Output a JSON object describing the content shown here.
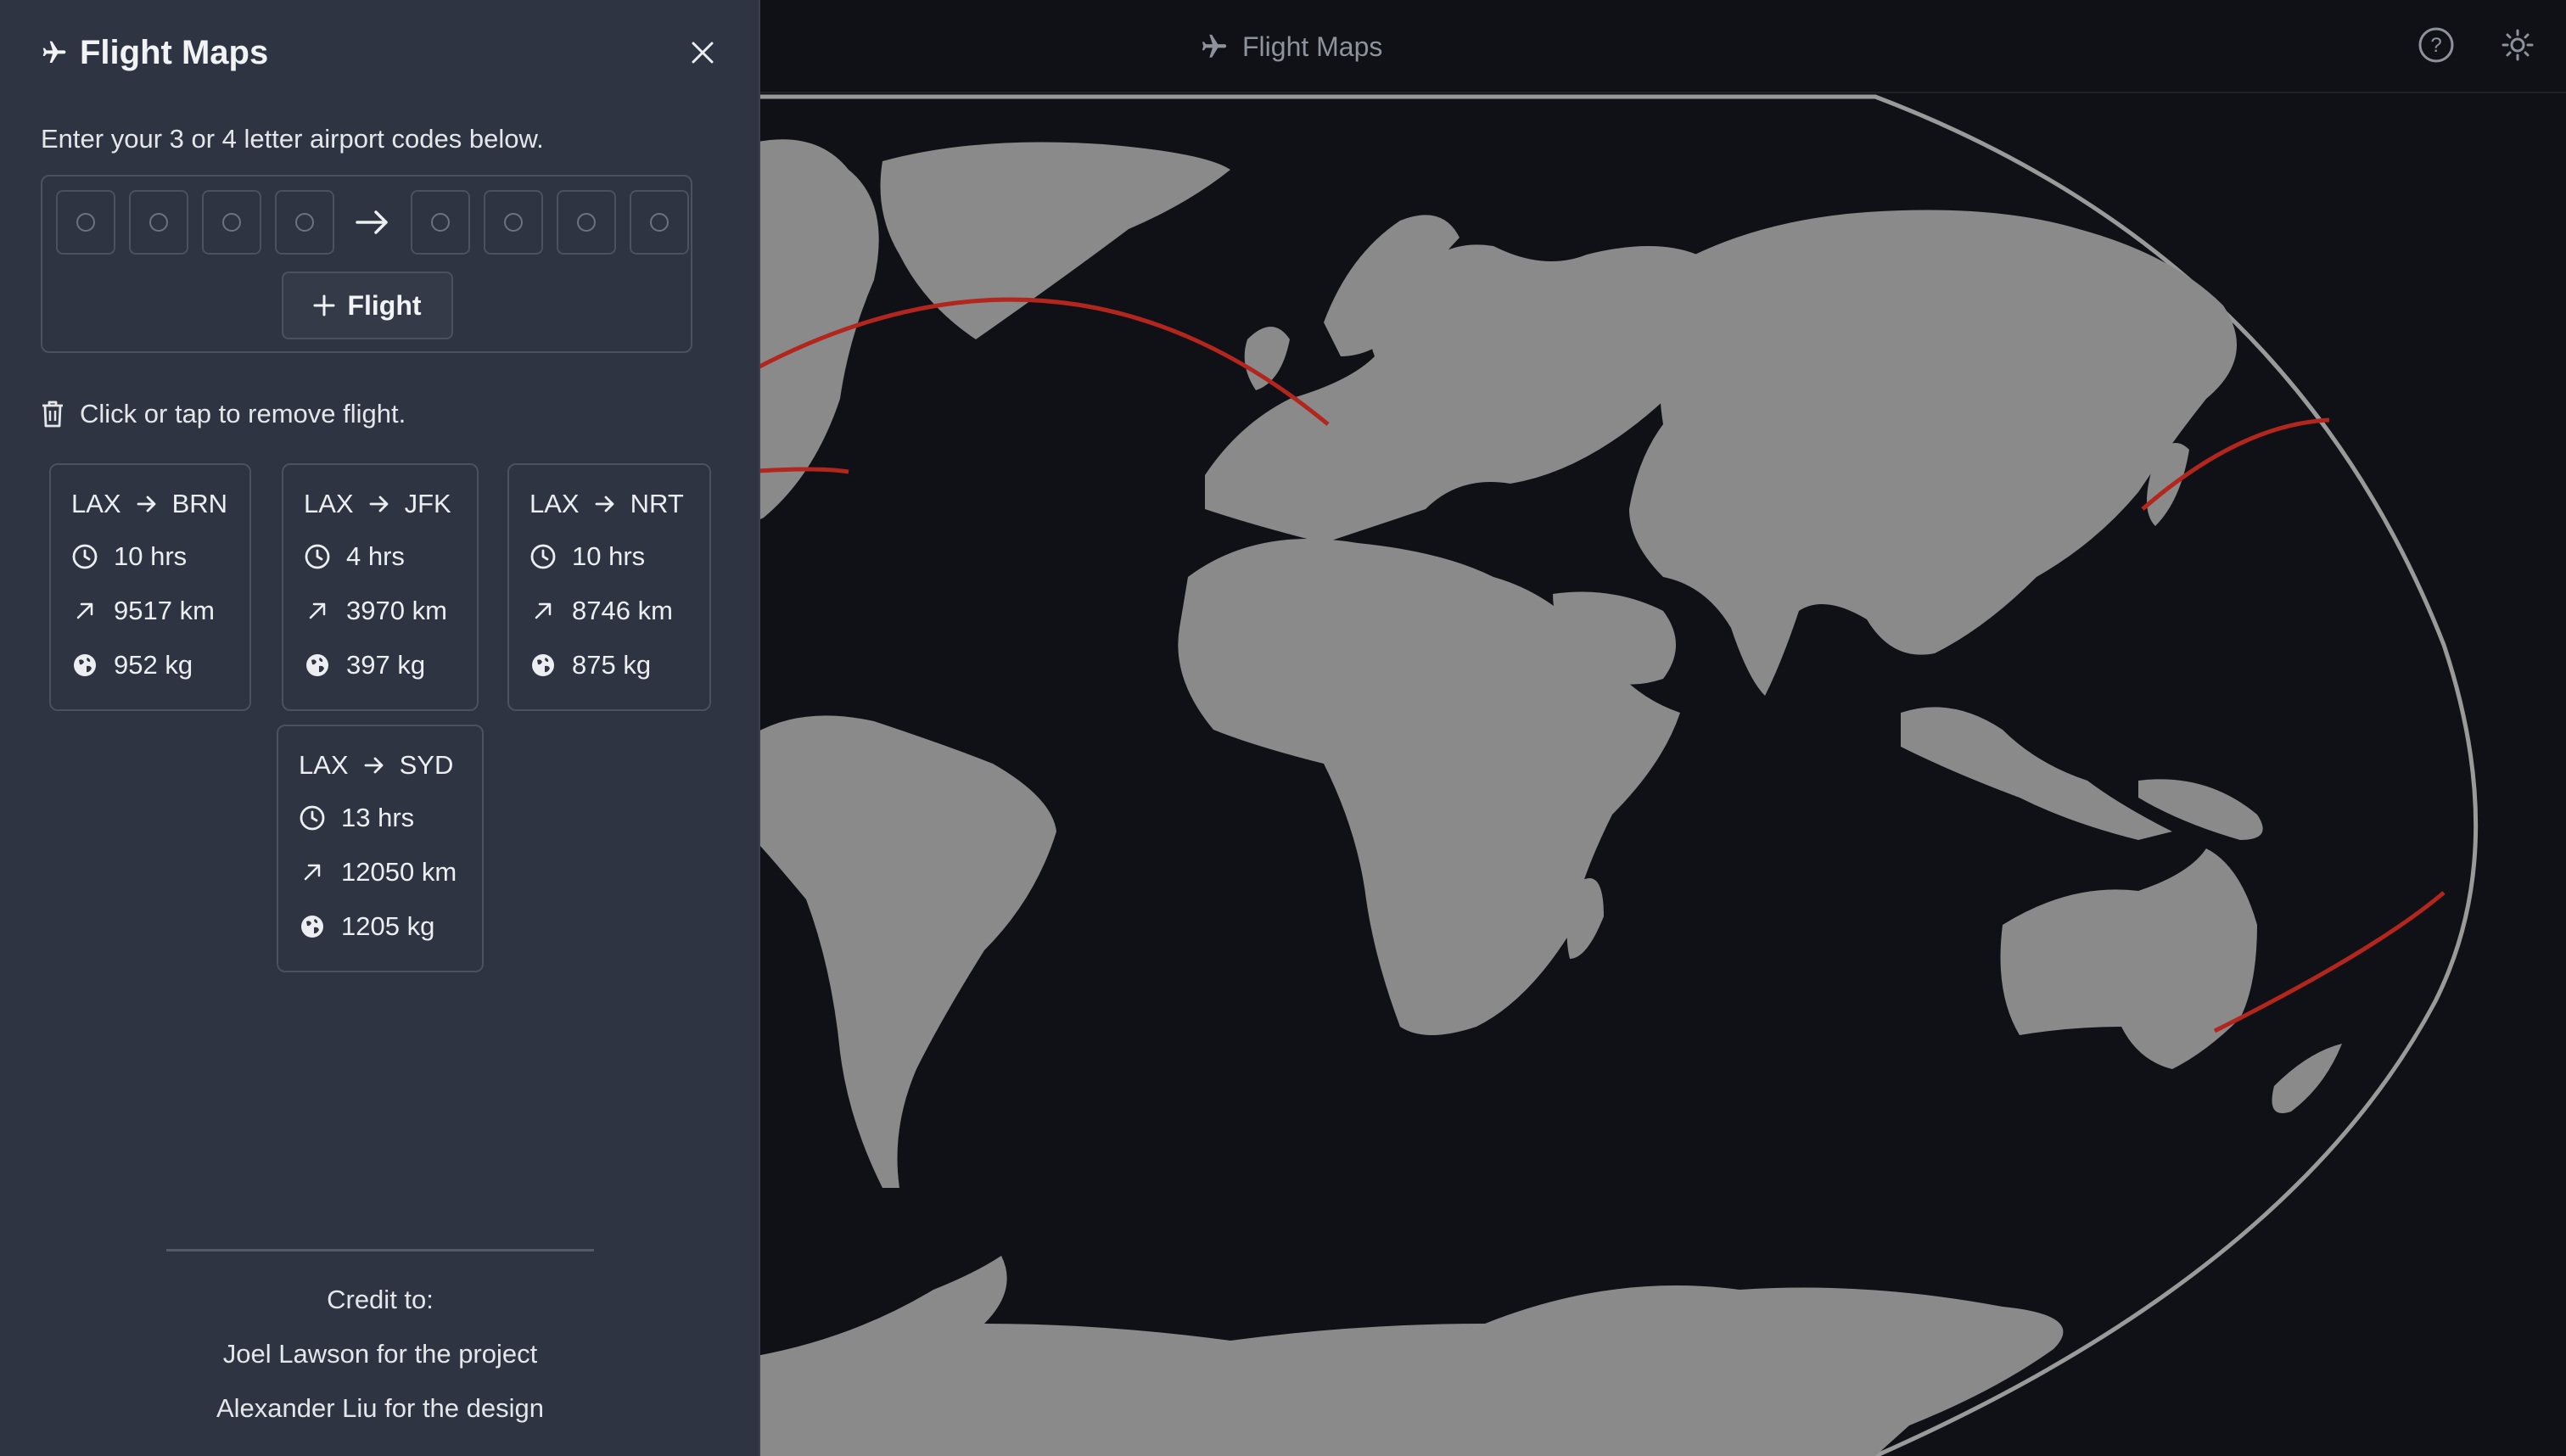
{
  "header": {
    "app_title": "Flight Maps",
    "icons": {
      "title": "plane-icon",
      "help": "question-circle-icon",
      "theme": "sun-icon"
    }
  },
  "sidebar": {
    "title": "Flight Maps",
    "instructions": "Enter your 3 or 4 letter airport codes below.",
    "origin_codes": [
      "",
      "",
      "",
      ""
    ],
    "destination_codes": [
      "",
      "",
      "",
      ""
    ],
    "add_button_label": "Flight",
    "remove_hint": "Click or tap to remove flight.",
    "flights": [
      {
        "from": "LAX",
        "to": "BRN",
        "duration": "10 hrs",
        "distance": "9517 km",
        "emissions": "952 kg"
      },
      {
        "from": "LAX",
        "to": "JFK",
        "duration": "4 hrs",
        "distance": "3970 km",
        "emissions": "397 kg"
      },
      {
        "from": "LAX",
        "to": "NRT",
        "duration": "10 hrs",
        "distance": "8746 km",
        "emissions": "875 kg"
      },
      {
        "from": "LAX",
        "to": "SYD",
        "duration": "13 hrs",
        "distance": "12050 km",
        "emissions": "1205 kg"
      }
    ],
    "credits": {
      "heading": "Credit to:",
      "project": "Joel Lawson for the project",
      "design": "Alexander Liu for the design"
    }
  },
  "colors": {
    "sidebar_bg": "#2e3441",
    "map_bg": "#0f1116",
    "land": "#8a8a8a",
    "route": "#b3261e",
    "outline": "#9a9a9a"
  }
}
